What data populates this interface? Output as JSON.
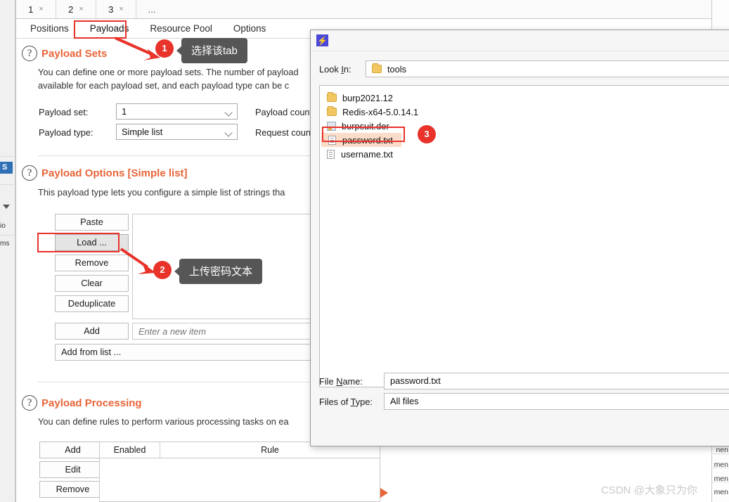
{
  "window": {
    "progress_visible": true,
    "accent_color": "#e8663a"
  },
  "left_rail": {
    "badge_label": "S",
    "fragments": [
      "io",
      "ms"
    ]
  },
  "number_tabs": [
    {
      "label": "1",
      "close": "×"
    },
    {
      "label": "2",
      "close": "×"
    },
    {
      "label": "3",
      "close": "×"
    },
    {
      "label": "...",
      "close": ""
    }
  ],
  "section_tabs": [
    {
      "label": "Positions",
      "active": false
    },
    {
      "label": "Payloads",
      "active": true
    },
    {
      "label": "Resource Pool",
      "active": false
    },
    {
      "label": "Options",
      "active": false
    }
  ],
  "payload_sets": {
    "help_icon": "question-icon",
    "title": "Payload Sets",
    "description": "You can define one or more payload sets. The number of payload\navailable for each payload set, and each payload type can be c",
    "payload_set_label": "Payload set:",
    "payload_set_value": "1",
    "payload_type_label": "Payload type:",
    "payload_type_value": "Simple list",
    "payload_count_label": "Payload count: (",
    "request_count_label": "Request count: ("
  },
  "payload_options": {
    "help_icon": "question-icon",
    "title": "Payload Options [Simple list]",
    "description": "This payload type lets you configure a simple list of strings tha",
    "buttons": [
      {
        "label": "Paste",
        "pressed": false
      },
      {
        "label": "Load ...",
        "pressed": true
      },
      {
        "label": "Remove",
        "pressed": false
      },
      {
        "label": "Clear",
        "pressed": false
      },
      {
        "label": "Deduplicate",
        "pressed": false
      }
    ],
    "add_label": "Add",
    "new_item_placeholder": "Enter a new item",
    "add_from_list_label": "Add from list ..."
  },
  "payload_processing": {
    "help_icon": "question-icon",
    "title": "Payload Processing",
    "description": "You can define rules to perform various processing tasks on ea",
    "buttons": [
      "Add",
      "Edit",
      "Remove"
    ],
    "columns": [
      "Enabled",
      "Rule"
    ]
  },
  "annotations": [
    {
      "number": "1",
      "text": "选择该tab"
    },
    {
      "number": "2",
      "text": "上传密码文本"
    },
    {
      "number": "3",
      "text": ""
    }
  ],
  "file_dialog": {
    "title_icon": "lightning-bolt-icon",
    "look_in_label": "Look In:",
    "look_in_value": "tools",
    "files": [
      {
        "name": "burp2021.12",
        "icon": "folder-icon",
        "selected": false
      },
      {
        "name": "Redis-x64-5.0.14.1",
        "icon": "folder-icon",
        "selected": false
      },
      {
        "name": "burpsuit.der",
        "icon": "certificate-icon",
        "selected": false
      },
      {
        "name": "password.txt",
        "icon": "text-file-icon",
        "selected": true
      },
      {
        "name": "username.txt",
        "icon": "text-file-icon",
        "selected": false
      }
    ],
    "file_name_label_pre": "File ",
    "file_name_label_key": "N",
    "file_name_label_post": "ame:",
    "file_name_value": "password.txt",
    "files_of_type_label_pre": "Files of ",
    "files_of_type_label_key": "T",
    "files_of_type_label_post": "ype:",
    "files_of_type_value": "All files"
  },
  "right_sliver": {
    "fragments": [
      "nen",
      "men",
      "men",
      "men"
    ]
  },
  "watermark": "CSDN @大象只为你"
}
